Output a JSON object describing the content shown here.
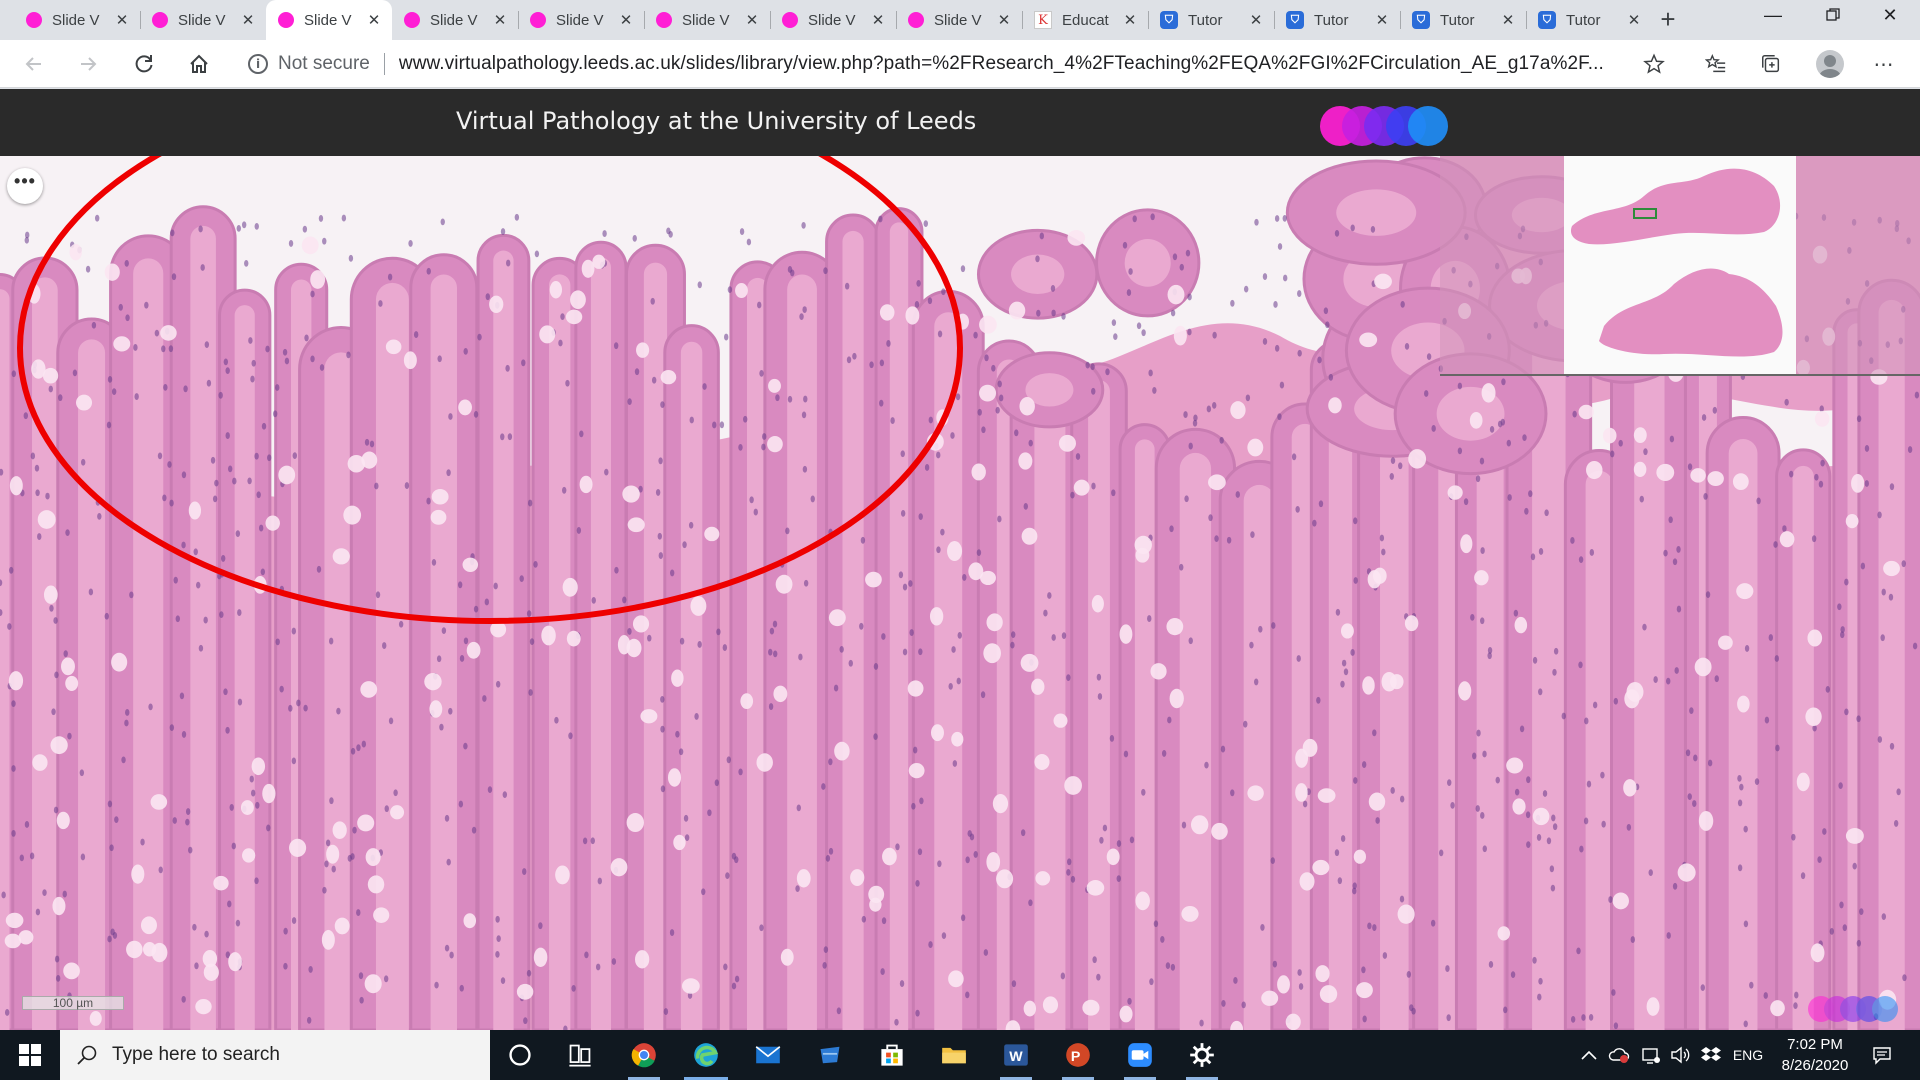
{
  "browser": {
    "tabs": [
      {
        "label": "Slide V",
        "favicon": "slide-favicon",
        "active": false
      },
      {
        "label": "Slide V",
        "favicon": "slide-favicon",
        "active": false
      },
      {
        "label": "Slide V",
        "favicon": "slide-favicon",
        "active": true
      },
      {
        "label": "Slide V",
        "favicon": "slide-favicon",
        "active": false
      },
      {
        "label": "Slide V",
        "favicon": "slide-favicon",
        "active": false
      },
      {
        "label": "Slide V",
        "favicon": "slide-favicon",
        "active": false
      },
      {
        "label": "Slide V",
        "favicon": "slide-favicon",
        "active": false
      },
      {
        "label": "Slide V",
        "favicon": "slide-favicon",
        "active": false
      },
      {
        "label": "Educat",
        "favicon": "education-favicon",
        "active": false
      },
      {
        "label": "Tutor",
        "favicon": "tutor-favicon",
        "active": false
      },
      {
        "label": "Tutor",
        "favicon": "tutor-favicon",
        "active": false
      },
      {
        "label": "Tutor",
        "favicon": "tutor-favicon",
        "active": false
      },
      {
        "label": "Tutor",
        "favicon": "tutor-favicon",
        "active": false
      }
    ],
    "security_label": "Not secure",
    "url": "www.virtualpathology.leeds.ac.uk/slides/library/view.php?path=%2FResearch_4%2FTeaching%2FEQA%2FGI%2FCirculation_AE_g17a%2F..."
  },
  "page": {
    "site_title": "Virtual Pathology at the University of Leeds",
    "logo_colors": [
      "#ff1fd5",
      "#c61fe0",
      "#7b2bf0",
      "#3d3ff2",
      "#1f8cf5"
    ],
    "menu_glyph": "•••",
    "scale_bar_label": "100 µm",
    "annotation_color": "#ee0000",
    "tissue_colors": {
      "stroma": "#e79fc8",
      "epithelium": "#d98ac0",
      "nuclei": "#6a3a8a",
      "goblet": "#fbe6f2",
      "lumen": "#f7f2f5"
    }
  },
  "taskbar": {
    "search_placeholder": "Type here to search",
    "language": "ENG",
    "time": "7:02 PM",
    "date": "8/26/2020",
    "pinned_apps": [
      "cortana-icon",
      "task-view-icon",
      "chrome-icon",
      "edge-icon",
      "mail-icon",
      "onedrive-icon",
      "store-icon",
      "file-explorer-icon",
      "word-icon",
      "powerpoint-icon",
      "zoom-icon",
      "settings-icon"
    ]
  }
}
